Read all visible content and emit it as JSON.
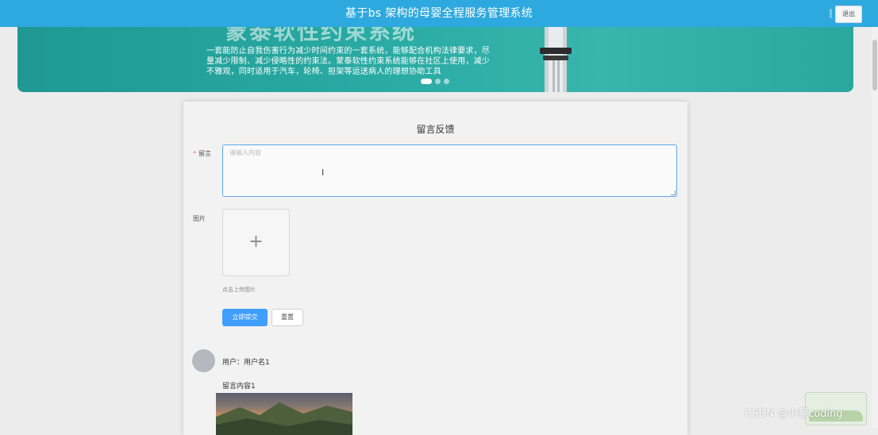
{
  "header": {
    "title": "基于bs 架构的母婴全程服务管理系统",
    "logout_label": "退出"
  },
  "banner": {
    "title": "蒙泰软性约束系统",
    "description": "一套能防止自我伤害行为减少时间约束的一套系统，能够配合机构法律要求，尽量减少限制、减少侵略性的约束法。蒙泰软性约束系统能够在社区上使用，减少不雅观，同时适用于汽车，轮椅、担架等运送病人的理想协助工具",
    "slides": [
      {
        "active": true
      },
      {
        "active": false
      },
      {
        "active": false
      }
    ]
  },
  "form": {
    "heading": "留言反馈",
    "message_label": "留言",
    "message_required_mark": "*",
    "message_placeholder": "请输入内容",
    "image_label": "图片",
    "upload_plus": "+",
    "upload_hint": "点击上传图片",
    "submit_label": "立即提交",
    "reset_label": "重置"
  },
  "comment": {
    "user_line": "用户：用户名1",
    "content": "留言内容1"
  },
  "watermark": "CSDN @小蔡coding",
  "colors": {
    "header_bg": "#2ea9df",
    "banner_bg": "#2aaba4",
    "primary_button": "#409eff",
    "required_mark": "#f56c6c"
  }
}
